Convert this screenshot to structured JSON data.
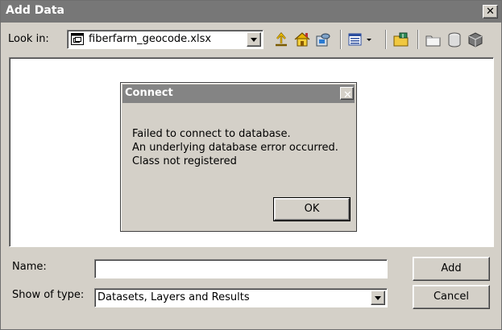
{
  "window": {
    "title": "Add Data"
  },
  "lookin": {
    "label": "Look in:",
    "value": "fiberfarm_geocode.xlsx"
  },
  "toolbar": {
    "icons": [
      "up-folder-icon",
      "home-icon",
      "catalog-icon",
      "view-menu-icon",
      "connect-folder-icon",
      "new-folder-icon",
      "new-shapefile-icon",
      "new-geodatabase-icon"
    ]
  },
  "connect_dialog": {
    "title": "Connect",
    "lines": [
      "Failed to connect to database.",
      "An underlying database error occurred.",
      "Class not registered"
    ],
    "ok_label": "OK"
  },
  "form": {
    "name_label": "Name:",
    "name_value": "",
    "type_label": "Show of type:",
    "type_value": "Datasets, Layers and Results",
    "add_label": "Add",
    "cancel_label": "Cancel"
  },
  "colors": {
    "titlebar": "#777777",
    "dialog_titlebar": "#848484",
    "face": "#d4d0c8"
  }
}
